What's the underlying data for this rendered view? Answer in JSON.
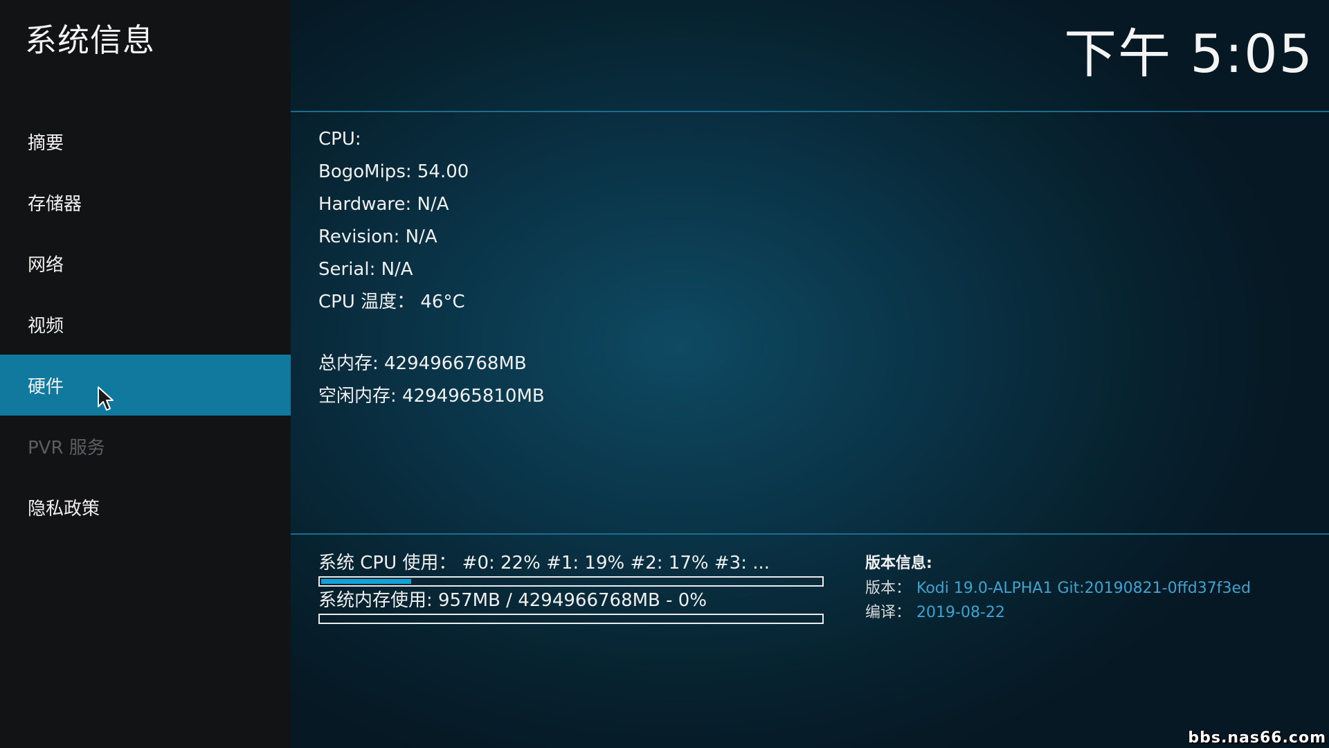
{
  "header": {
    "title": "系统信息",
    "clock": "下午 5:05"
  },
  "sidebar": {
    "items": [
      {
        "label": "摘要"
      },
      {
        "label": "存储器"
      },
      {
        "label": "网络"
      },
      {
        "label": "视频"
      },
      {
        "label": "硬件",
        "state": "active"
      },
      {
        "label": "PVR 服务",
        "state": "disabled"
      },
      {
        "label": "隐私政策"
      }
    ]
  },
  "hardware": {
    "lines": [
      "CPU:",
      "BogoMips: 54.00",
      "Hardware: N/A",
      "Revision: N/A",
      "Serial: N/A",
      "CPU 温度： 46°C"
    ],
    "memory": [
      "总内存: 4294966768MB",
      "空闲内存: 4294965810MB"
    ]
  },
  "usage": {
    "cpu_label": "系统 CPU 使用： #0:  22% #1:  19% #2:  17% #3:  ...",
    "cpu_fraction": 0.18,
    "mem_label": "系统内存使用: 957MB / 4294966768MB - 0%",
    "mem_fraction": 0.0
  },
  "version_info": {
    "title": "版本信息:",
    "version_key": "版本：",
    "version_value": "Kodi 19.0-ALPHA1 Git:20190821-0ffd37f3ed",
    "build_key": "编译：",
    "build_value": "2019-08-22"
  },
  "watermark": "bbs.nas66.com",
  "colors": {
    "accent": "#12799e",
    "value_text": "#3ea3d1",
    "bar_fill": "#12a3d6"
  }
}
